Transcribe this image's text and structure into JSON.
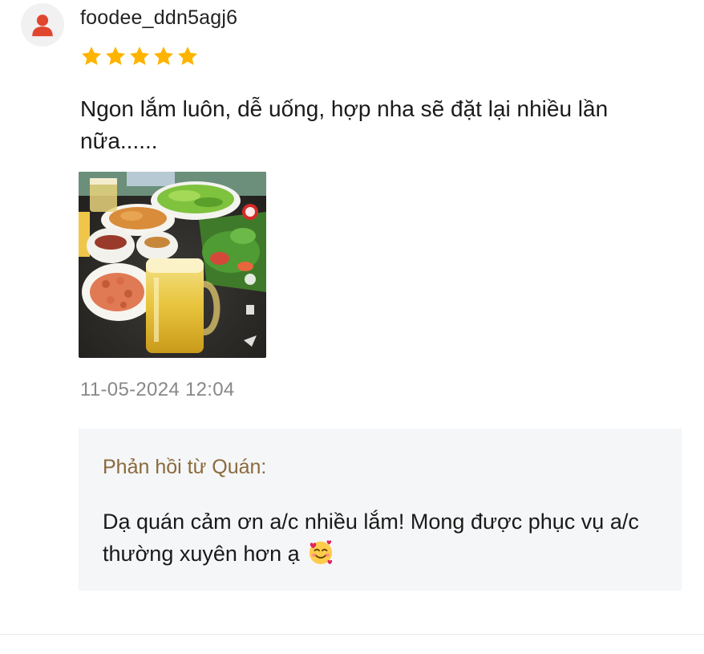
{
  "review": {
    "username": "foodee_ddn5agj6",
    "rating": 5,
    "max_rating": 5,
    "text": "Ngon lắm luôn, dễ uống, hợp nha sẽ đặt lại nhiều lần nữa......",
    "timestamp": "11-05-2024 12:04",
    "photo_icon": "review-photo",
    "star_color": "#ffb400"
  },
  "reply": {
    "label": "Phản hồi từ Quán:",
    "text": "Dạ quán cảm ơn a/c nhiều lắm! Mong được phục vụ a/c thường xuyên hơn ạ",
    "emoji_icon": "smiling-face-with-hearts-icon",
    "label_color": "#8a6a3b",
    "background": "#f5f6f8"
  },
  "avatar": {
    "icon": "user-icon",
    "color": "#e0452e"
  }
}
